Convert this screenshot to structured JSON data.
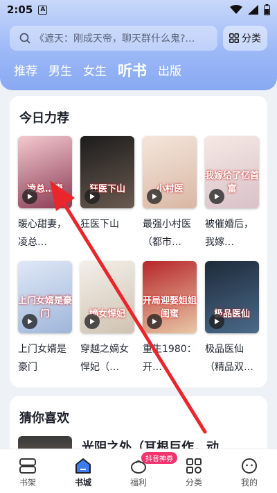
{
  "status_bar": {
    "time": "2:05",
    "notification_badge": "A"
  },
  "search": {
    "placeholder": "《遮天：刚成天帝，聊天群什么鬼?…",
    "category_label": "分类"
  },
  "tabs": [
    {
      "label": "推荐",
      "active": false
    },
    {
      "label": "男生",
      "active": false
    },
    {
      "label": "女生",
      "active": false
    },
    {
      "label": "听书",
      "active": true
    },
    {
      "label": "出版",
      "active": false
    }
  ],
  "today_pick": {
    "title": "今日力荐",
    "books": [
      {
        "title": "暖心甜妻，凌总…",
        "cover_text": "凌总…妻",
        "colors": [
          "#f3c9cf",
          "#8a3b55"
        ]
      },
      {
        "title": "狂医下山",
        "cover_text": "狂医下山",
        "colors": [
          "#1c1c1c",
          "#6a5a50"
        ]
      },
      {
        "title": "最强小村医（都市…",
        "cover_text": "小村医",
        "colors": [
          "#f4e6dc",
          "#d9b7a3"
        ]
      },
      {
        "title": "被催婚后，我嫁…",
        "cover_text": "我嫁给了亿首富",
        "colors": [
          "#f6e8e4",
          "#d8c2c8"
        ]
      },
      {
        "title": "上门女婿是豪门",
        "cover_text": "上门女婿是豪门",
        "colors": [
          "#dfe8f6",
          "#9fb6da"
        ]
      },
      {
        "title": "穿越之嫡女悍妃（…",
        "cover_text": "嫡女悍妃",
        "colors": [
          "#f3efe8",
          "#cfc3b2"
        ]
      },
      {
        "title": "重生1980：开…",
        "cover_text": "开局迎娶姐姐闺蜜",
        "colors": [
          "#b7262a",
          "#e9c8a6"
        ]
      },
      {
        "title": "极品医仙（精品双…",
        "cover_text": "极品医仙",
        "colors": [
          "#1e2a3a",
          "#4a6b8a"
        ]
      }
    ]
  },
  "guess": {
    "title": "猜你喜欢",
    "first_item_title": "光阴之外（耳根巨作，动"
  },
  "bottom_nav": [
    {
      "label": "书架",
      "icon": "bookshelf-icon",
      "active": false
    },
    {
      "label": "书城",
      "icon": "bookstore-icon",
      "active": true
    },
    {
      "label": "福利",
      "icon": "gift-icon",
      "active": false,
      "badge": "抖音神券"
    },
    {
      "label": "分类",
      "icon": "grid-icon",
      "active": false
    },
    {
      "label": "我的",
      "icon": "profile-icon",
      "active": false
    }
  ],
  "colors": {
    "accent": "#3d7bf2",
    "annotation_arrow": "#e8262b"
  }
}
